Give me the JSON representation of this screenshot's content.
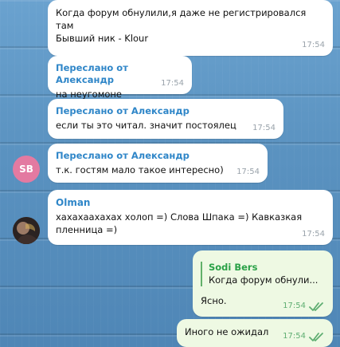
{
  "messages": [
    {
      "id": "m1",
      "lines": [
        "Когда форум обнулили,я даже не регистрировался",
        "там",
        "Бывший ник - Klour"
      ],
      "time": "17:54"
    },
    {
      "id": "m2",
      "forwarded_from": "Переслано от Александр",
      "text": "на неугомоне",
      "time": "17:54"
    },
    {
      "id": "m3",
      "forwarded_from": "Переслано от Александр",
      "text": "если ты это читал. значит постоялец",
      "time": "17:54"
    },
    {
      "id": "m4",
      "forwarded_from": "Переслано от Александр",
      "text": "т.к. гостям мало такое интересно)",
      "time": "17:54",
      "avatar_initials": "SB"
    },
    {
      "id": "m5",
      "sender": "Olman",
      "lines": [
        "хахахаахахах холоп =) Слова Шпака =) Кавказкая",
        "пленница =)"
      ],
      "time": "17:54"
    },
    {
      "id": "m6",
      "reply_to": {
        "name": "Sodi Bers",
        "text": "Когда форум обнули..."
      },
      "text": "Ясно.",
      "time": "17:54"
    },
    {
      "id": "m7",
      "text": "Иного не ожидал",
      "time": "17:54"
    }
  ],
  "colors": {
    "link_blue": "#2f86c8",
    "reply_green": "#2aa147",
    "outgoing_bubble": "#eef9e3",
    "incoming_bubble": "#ffffff",
    "avatar_sb": "#e37aa1"
  }
}
